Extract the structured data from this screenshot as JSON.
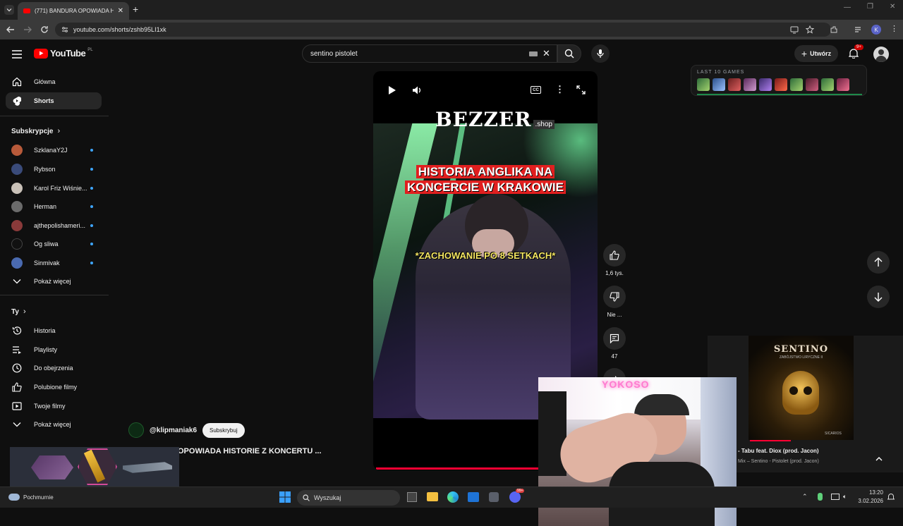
{
  "browser": {
    "tab_title": "(771) BANDURA OPOWIADA H",
    "url": "youtube.com/shorts/zshb95LI1xk",
    "profile_initial": "K"
  },
  "header": {
    "logo_text": "YouTube",
    "country_code": "PL",
    "search_value": "sentino pistolet",
    "create_label": "Utwórz",
    "notification_count": "9+"
  },
  "sidebar": {
    "main": [
      {
        "label": "Główna",
        "icon": "home-icon"
      },
      {
        "label": "Shorts",
        "icon": "shorts-icon"
      }
    ],
    "subscriptions_title": "Subskrypcje",
    "subscriptions": [
      {
        "label": "SzklanaY2J",
        "color": "#b85a3a"
      },
      {
        "label": "Rybson",
        "color": "#3a4b7a"
      },
      {
        "label": "Karol Friz Wiśnie...",
        "color": "#c9c1b8"
      },
      {
        "label": "Herman",
        "color": "#6b6b6b"
      },
      {
        "label": "ajthepolishameri...",
        "color": "#8a3a3a"
      },
      {
        "label": "Og sliwa",
        "color": "#111111"
      },
      {
        "label": "Sinmivak",
        "color": "#4a6ab0"
      }
    ],
    "subscriptions_more": "Pokaż więcej",
    "you_title": "Ty",
    "you_items": [
      {
        "label": "Historia",
        "icon": "history-icon"
      },
      {
        "label": "Playlisty",
        "icon": "playlist-icon"
      },
      {
        "label": "Do obejrzenia",
        "icon": "clock-icon"
      },
      {
        "label": "Polubione filmy",
        "icon": "thumb-up-icon"
      },
      {
        "label": "Twoje filmy",
        "icon": "video-icon"
      }
    ],
    "you_more": "Pokaż więcej"
  },
  "video": {
    "brand_text": "BEZZER",
    "brand_suffix": ".shop",
    "caption_line1": "HISTORIA ANGLIKA NA",
    "caption_line2": "KONCERCIE W KRAKOWIE",
    "caption_sub": "*ZACHOWANIE PO 8 SETKACH*",
    "channel_handle": "@klipmaniak6",
    "subscribe_label": "Subskrybuj",
    "title": "OPOWIADA HISTORIE Z KONCERTU ...",
    "progress": 1.0
  },
  "actions": {
    "likes": "1,6 tys.",
    "dislike_label": "Nie ...",
    "comments": "47"
  },
  "overlays": {
    "games_title": "LAST 10 GAMES",
    "mini_player_title": "- Tabu feat. Diox (prod. Jacon)",
    "mini_player_subtitle": "Mix – Sentino - Pistolet (prod. Jacon)",
    "album_artist": "SENTINO",
    "album_title": "ZABÓJSTWO LIRYCZNE II",
    "album_footer": "SICARIOS",
    "webcam_sign_text": "YOKOSO"
  },
  "taskbar": {
    "weather": "Pochmurnie",
    "search_placeholder": "Wyszukaj",
    "time": "13:20",
    "date": "3.02.2026",
    "mail_badge": "99+"
  }
}
